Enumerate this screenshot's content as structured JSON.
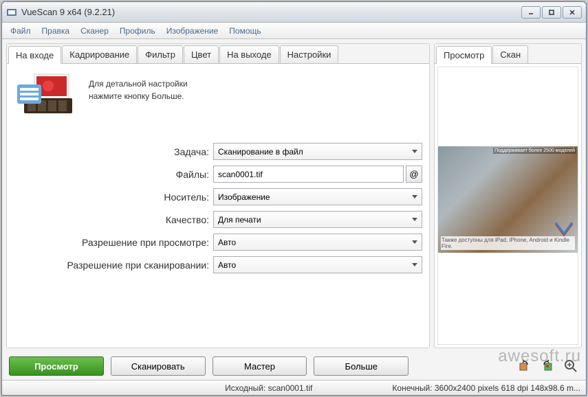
{
  "window": {
    "title": "VueScan 9 x64 (9.2.21)"
  },
  "menu": {
    "items": [
      "Файл",
      "Правка",
      "Сканер",
      "Профиль",
      "Изображение",
      "Помощь"
    ]
  },
  "leftTabs": {
    "items": [
      "На входе",
      "Кадрирование",
      "Фильтр",
      "Цвет",
      "На выходе",
      "Настройки"
    ],
    "active": 0
  },
  "rightTabs": {
    "items": [
      "Просмотр",
      "Скан"
    ],
    "active": 0
  },
  "intro": {
    "line1": "Для детальной настройки",
    "line2": "нажмите кнопку Больше."
  },
  "form": {
    "task": {
      "label": "Задача:",
      "value": "Сканирование в файл"
    },
    "files": {
      "label": "Файлы:",
      "value": "scan0001.tif",
      "at": "@"
    },
    "media": {
      "label": "Носитель:",
      "value": "Изображение"
    },
    "quality": {
      "label": "Качество:",
      "value": "Для печати"
    },
    "previewRes": {
      "label": "Разрешение при просмотре:",
      "value": "Авто"
    },
    "scanRes": {
      "label": "Разрешение при сканировании:",
      "value": "Авто"
    }
  },
  "preview": {
    "caption": "Также доступны для iPad, iPhone, Android и Kindle Fire.",
    "topCaption": "Поддерживает более 2500 моделей"
  },
  "actions": {
    "preview": "Просмотр",
    "scan": "Сканировать",
    "wizard": "Мастер",
    "more": "Больше"
  },
  "status": {
    "source": "Исходный: scan0001.tif",
    "output": "Конечный: 3600x2400 pixels 618 dpi 148x98.6 m..."
  },
  "watermark": "awesoft.ru"
}
